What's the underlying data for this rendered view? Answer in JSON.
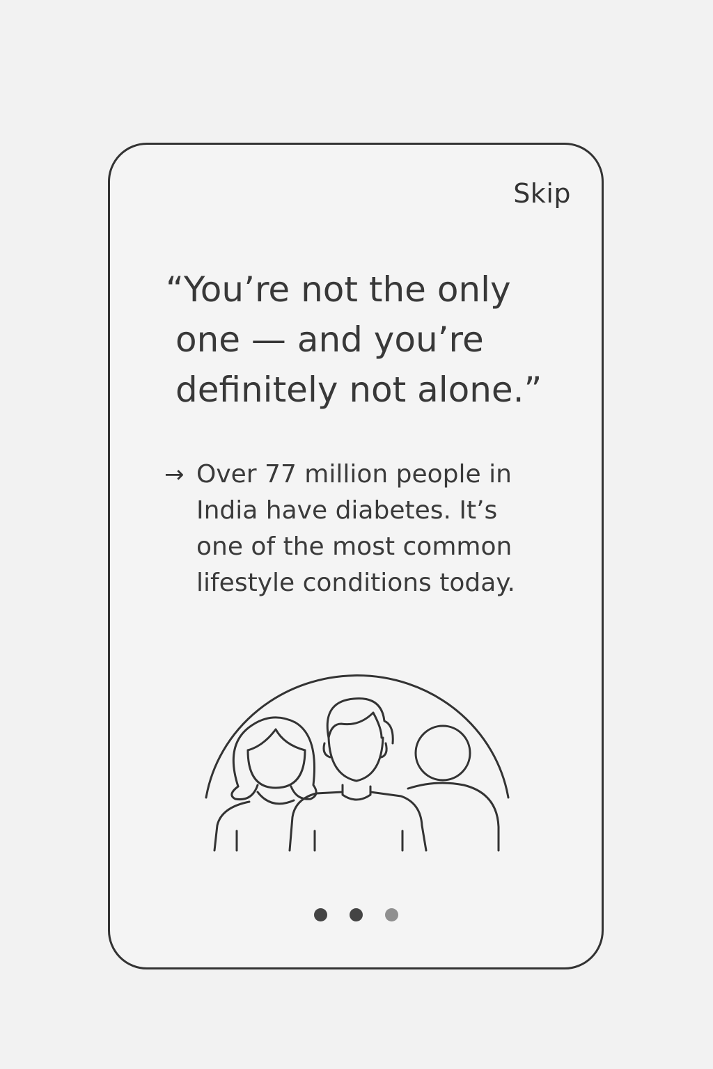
{
  "onboarding": {
    "skip_label": "Skip",
    "headline_lines": [
      "“You’re not the only",
      "one — and you’re",
      "definitely not alone.”"
    ],
    "stat_arrow": "→",
    "stat_lines": [
      "Over 77 million people in",
      "India have diabetes. It’s",
      "one of the most common",
      "lifestyle conditions today."
    ],
    "illustration_icon": "people-group-icon",
    "pagination": {
      "total": 3,
      "active_dots": [
        1,
        2
      ],
      "inactive_dots": [
        3
      ]
    }
  },
  "colors": {
    "background": "#f2f2f2",
    "card_border": "#333333",
    "text": "#333333",
    "dot_active": "#444444",
    "dot_inactive": "#8f8f8f"
  }
}
